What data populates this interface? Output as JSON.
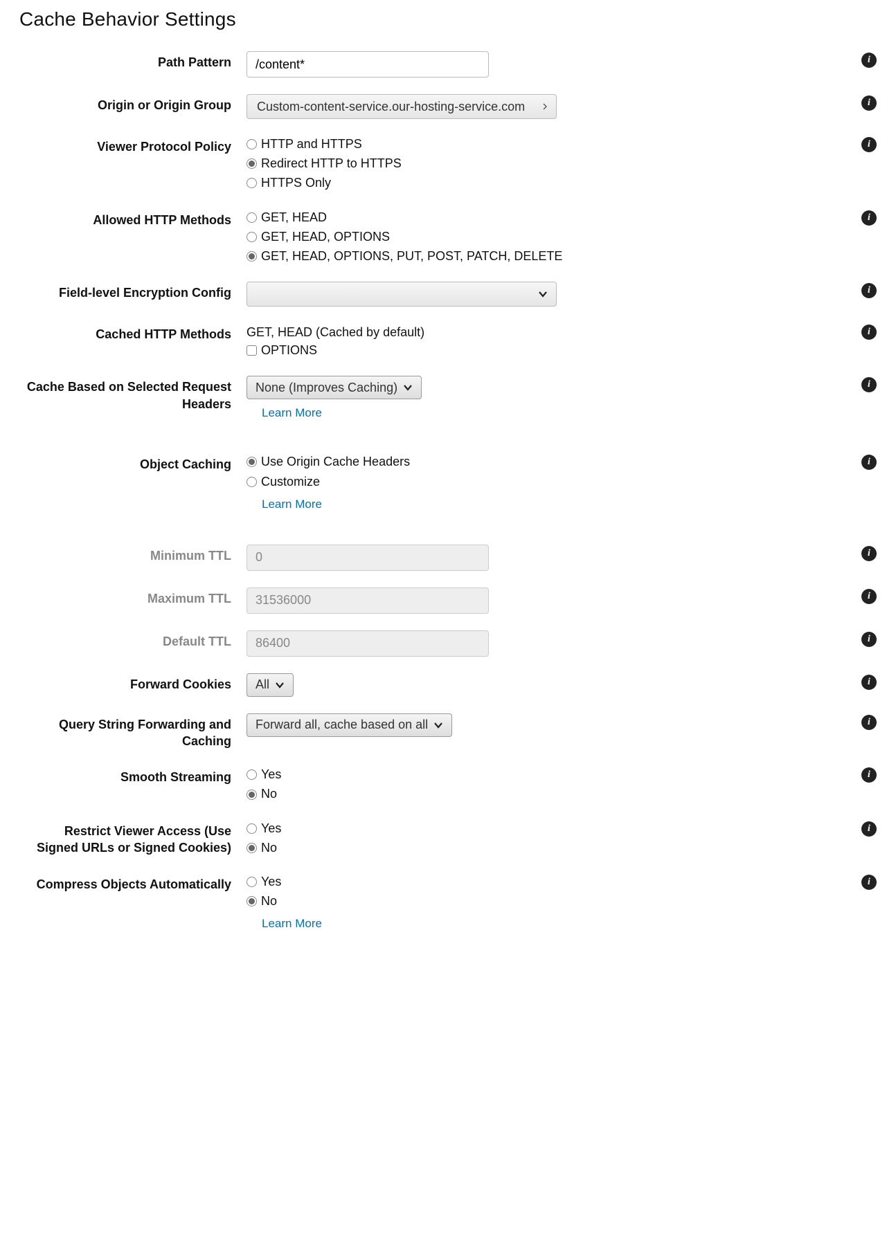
{
  "page_title": "Cache Behavior Settings",
  "learn_more": "Learn More",
  "path_pattern": {
    "label": "Path Pattern",
    "value": "/content*"
  },
  "origin": {
    "label": "Origin or Origin Group",
    "value": "Custom-content-service.our-hosting-service.com"
  },
  "viewer_protocol": {
    "label": "Viewer Protocol Policy",
    "options": [
      "HTTP and HTTPS",
      "Redirect HTTP to HTTPS",
      "HTTPS Only"
    ],
    "selected_index": 1
  },
  "allowed_http": {
    "label": "Allowed HTTP Methods",
    "options": [
      "GET, HEAD",
      "GET, HEAD, OPTIONS",
      "GET, HEAD, OPTIONS, PUT, POST, PATCH, DELETE"
    ],
    "selected_index": 2
  },
  "field_encryption": {
    "label": "Field-level Encryption Config",
    "value": ""
  },
  "cached_http": {
    "label": "Cached HTTP Methods",
    "static_text": "GET, HEAD (Cached by default)",
    "checkbox_label": "OPTIONS",
    "checkbox_checked": false
  },
  "cache_headers": {
    "label": "Cache Based on Selected Request Headers",
    "value": "None (Improves Caching)"
  },
  "object_caching": {
    "label": "Object Caching",
    "options": [
      "Use Origin Cache Headers",
      "Customize"
    ],
    "selected_index": 0
  },
  "min_ttl": {
    "label": "Minimum TTL",
    "value": "0"
  },
  "max_ttl": {
    "label": "Maximum TTL",
    "value": "31536000"
  },
  "default_ttl": {
    "label": "Default TTL",
    "value": "86400"
  },
  "forward_cookies": {
    "label": "Forward Cookies",
    "value": "All"
  },
  "query_string": {
    "label": "Query String Forwarding and Caching",
    "value": "Forward all, cache based on all"
  },
  "smooth_streaming": {
    "label": "Smooth Streaming",
    "options": [
      "Yes",
      "No"
    ],
    "selected_index": 1
  },
  "restrict_viewer": {
    "label": "Restrict Viewer Access (Use Signed URLs or Signed Cookies)",
    "options": [
      "Yes",
      "No"
    ],
    "selected_index": 1
  },
  "compress": {
    "label": "Compress Objects Automatically",
    "options": [
      "Yes",
      "No"
    ],
    "selected_index": 1
  }
}
